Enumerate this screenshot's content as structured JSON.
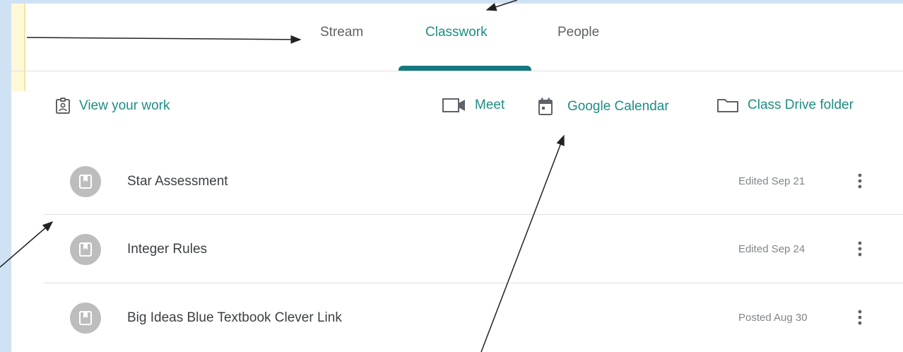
{
  "tabs": [
    {
      "label": "Stream"
    },
    {
      "label": "Classwork",
      "active": true
    },
    {
      "label": "People"
    }
  ],
  "toolbar": {
    "view_work": "View your work",
    "meet": "Meet",
    "calendar": "Google Calendar",
    "drive": "Class Drive folder"
  },
  "items": [
    {
      "title": "Star Assessment",
      "meta": "Edited Sep 21",
      "icon": "material-icon"
    },
    {
      "title": "Integer Rules",
      "meta": "Edited Sep 24",
      "icon": "material-icon"
    },
    {
      "title": "Big Ideas Blue Textbook Clever Link",
      "meta": "Posted Aug 30",
      "icon": "material-icon"
    }
  ],
  "colors": {
    "accent": "#1e8e83",
    "indicator": "#137a7f",
    "background": "#cfe2f3",
    "avatar": "#bdbdbd"
  }
}
